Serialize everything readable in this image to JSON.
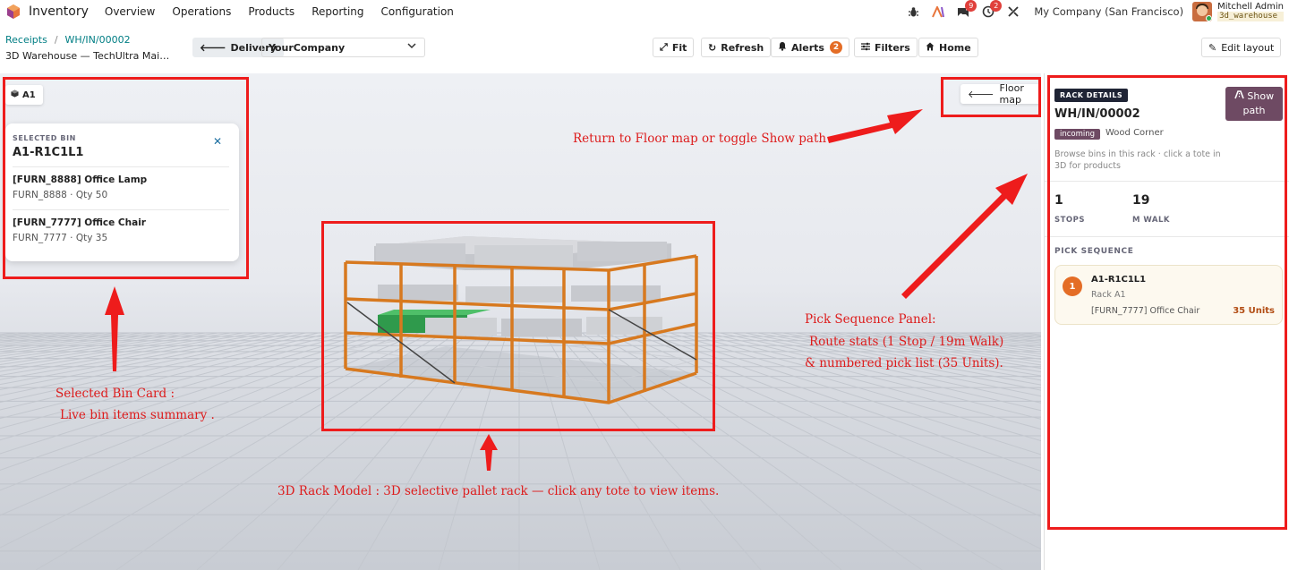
{
  "nav": {
    "app_name": "Inventory",
    "menu": [
      "Overview",
      "Operations",
      "Products",
      "Reporting",
      "Configuration"
    ],
    "chat_count": "9",
    "activity_count": "2",
    "company": "My Company (San Francisco)",
    "user_name": "Mitchell Admin",
    "db_name": "3d_warehouse"
  },
  "controls": {
    "breadcrumb_root": "Receipts",
    "breadcrumb_current": "WH/IN/00002",
    "subtitle": "3D Warehouse — TechUltra Main ...",
    "delivery_label": "Delivery",
    "company_select": "YourCompany",
    "fit_label": "Fit",
    "refresh_label": "Refresh",
    "alerts_label": "Alerts",
    "alerts_count": "2",
    "filters_label": "Filters",
    "home_label": "Home",
    "edit_layout_label": "Edit layout"
  },
  "viewport": {
    "level_chip": "A1",
    "floor_map_label": "Floor map",
    "bin_card": {
      "label": "SELECTED BIN",
      "code": "A1-R1C1L1",
      "close": "✕",
      "items": [
        {
          "name": "[FURN_8888] Office Lamp",
          "meta": "FURN_8888 · Qty 50"
        },
        {
          "name": "[FURN_7777] Office Chair",
          "meta": "FURN_7777 · Qty 35"
        }
      ]
    }
  },
  "panel": {
    "tag": "RACK DETAILS",
    "title": "WH/IN/00002",
    "show_path_label": "Show path",
    "state": "incoming",
    "location": "Wood Corner",
    "hint": "Browse bins in this rack · click a tote in 3D for products",
    "stops_value": "1",
    "stops_label": "STOPS",
    "walk_value": "19",
    "walk_label": "M WALK",
    "sequence_label": "PICK SEQUENCE",
    "picks": [
      {
        "num": "1",
        "bin": "A1-R1C1L1",
        "rack": "Rack A1",
        "product": "[FURN_7777] Office Chair",
        "qty": "35 Units"
      }
    ]
  },
  "annotations": {
    "floor_map": "Return to Floor map or toggle Show path",
    "bin_card_line1": "Selected Bin Card :",
    "bin_card_line2": "Live bin items summary .",
    "rack_model": "3D Rack Model :  3D selective pallet rack — click any tote to view items.",
    "panel_line1": "Pick Sequence Panel:",
    "panel_line2": "Route stats (1 Stop / 19m Walk)",
    "panel_line3": "& numbered pick list (35 Units)."
  },
  "colors": {
    "accent": "#017e84",
    "primary": "#6e4a63",
    "annotation": "#ee1c1c",
    "rack_frame": "#d7791f",
    "highlight_tote": "#2f9a4c"
  }
}
